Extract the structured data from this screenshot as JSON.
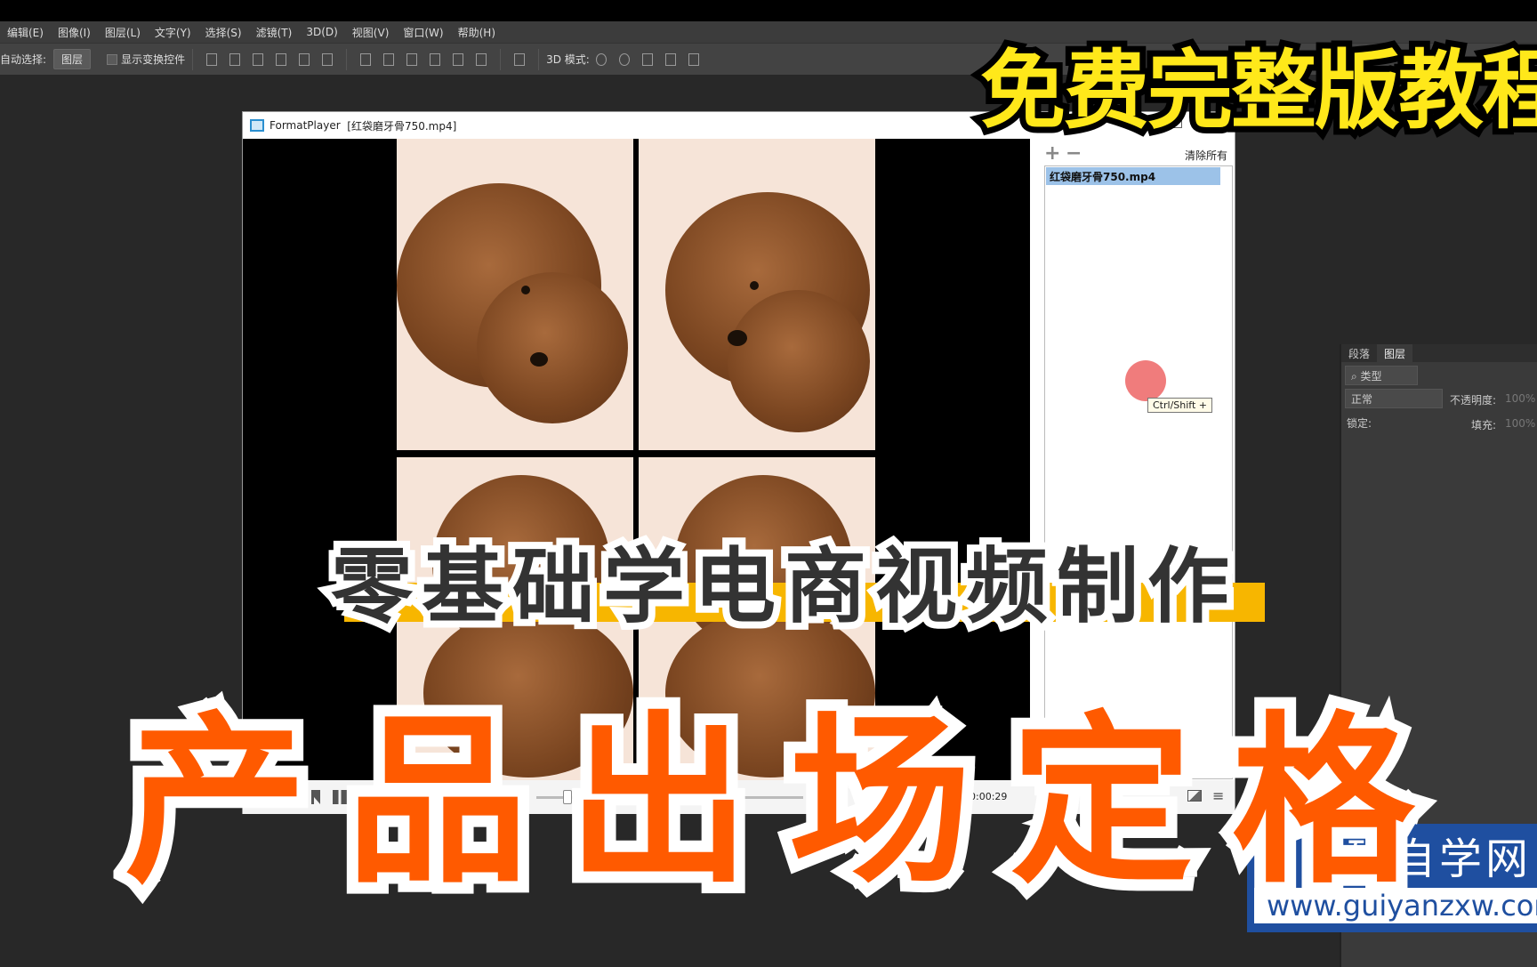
{
  "menubar": [
    "编辑(E)",
    "图像(I)",
    "图层(L)",
    "文字(Y)",
    "选择(S)",
    "滤镜(T)",
    "3D(D)",
    "视图(V)",
    "窗口(W)",
    "帮助(H)"
  ],
  "options": {
    "auto_select": "自动选择:",
    "layer_select": "图层",
    "show_transform": "显示变换控件",
    "mode_3d": "3D 模式:"
  },
  "player": {
    "app": "FormatPlayer",
    "file": "[红袋磨牙骨750.mp4]",
    "add": "+",
    "remove": "−",
    "clear_all": "清除所有",
    "playlist": [
      "红袋磨牙骨750.mp4"
    ],
    "time": "0:00:29",
    "tooltip": "Ctrl/Shift +"
  },
  "pspanel": {
    "tabs": [
      "段落",
      "图层"
    ],
    "filter": "类型",
    "blend": "正常",
    "opacity_label": "不透明度:",
    "opacity": "100%",
    "lock_label": "锁定:",
    "fill_label": "填充:",
    "fill": "100%"
  },
  "captions": {
    "top": "免费完整版教程",
    "subtitle": "零基础学电商视频制作",
    "main": "产品出场定格"
  },
  "logo": {
    "name": "归研自学网",
    "url": "www.guiyanzxw.com"
  },
  "colors": {
    "caption_top": "#ffe81a",
    "caption_main": "#ff5a00",
    "subtitle_bar": "#f7b600",
    "logo_bg": "#1f4fa0"
  }
}
